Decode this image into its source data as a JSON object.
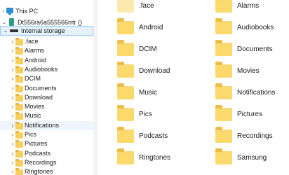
{
  "nav": {
    "this_pc": "This PC",
    "device": "Dt556ra6a555566rrtr ()",
    "storage": "Internal storage",
    "folders": [
      ".face",
      "Alarms",
      "Android",
      "Audiobooks",
      "DCIM",
      "Documents",
      "Download",
      "Movies",
      "Music",
      "Notifications",
      "Pics",
      "Pictures",
      "Podcasts",
      "Recordings",
      "Ringtones"
    ],
    "hovered": "Notifications"
  },
  "content": {
    "items": [
      ".face",
      "Alarms",
      "Android",
      "Audiobooks",
      "DCIM",
      "Documents",
      "Download",
      "Movies",
      "Music",
      "Notifications",
      "Pics",
      "Pictures",
      "Podcasts",
      "Recordings",
      "Ringtones",
      "Samsung"
    ]
  },
  "colors": {
    "folder": "#f8d775",
    "selection": "#e5f1fb",
    "selection_border": "#99c9ef",
    "pc_icon": "#2f8fd6"
  }
}
